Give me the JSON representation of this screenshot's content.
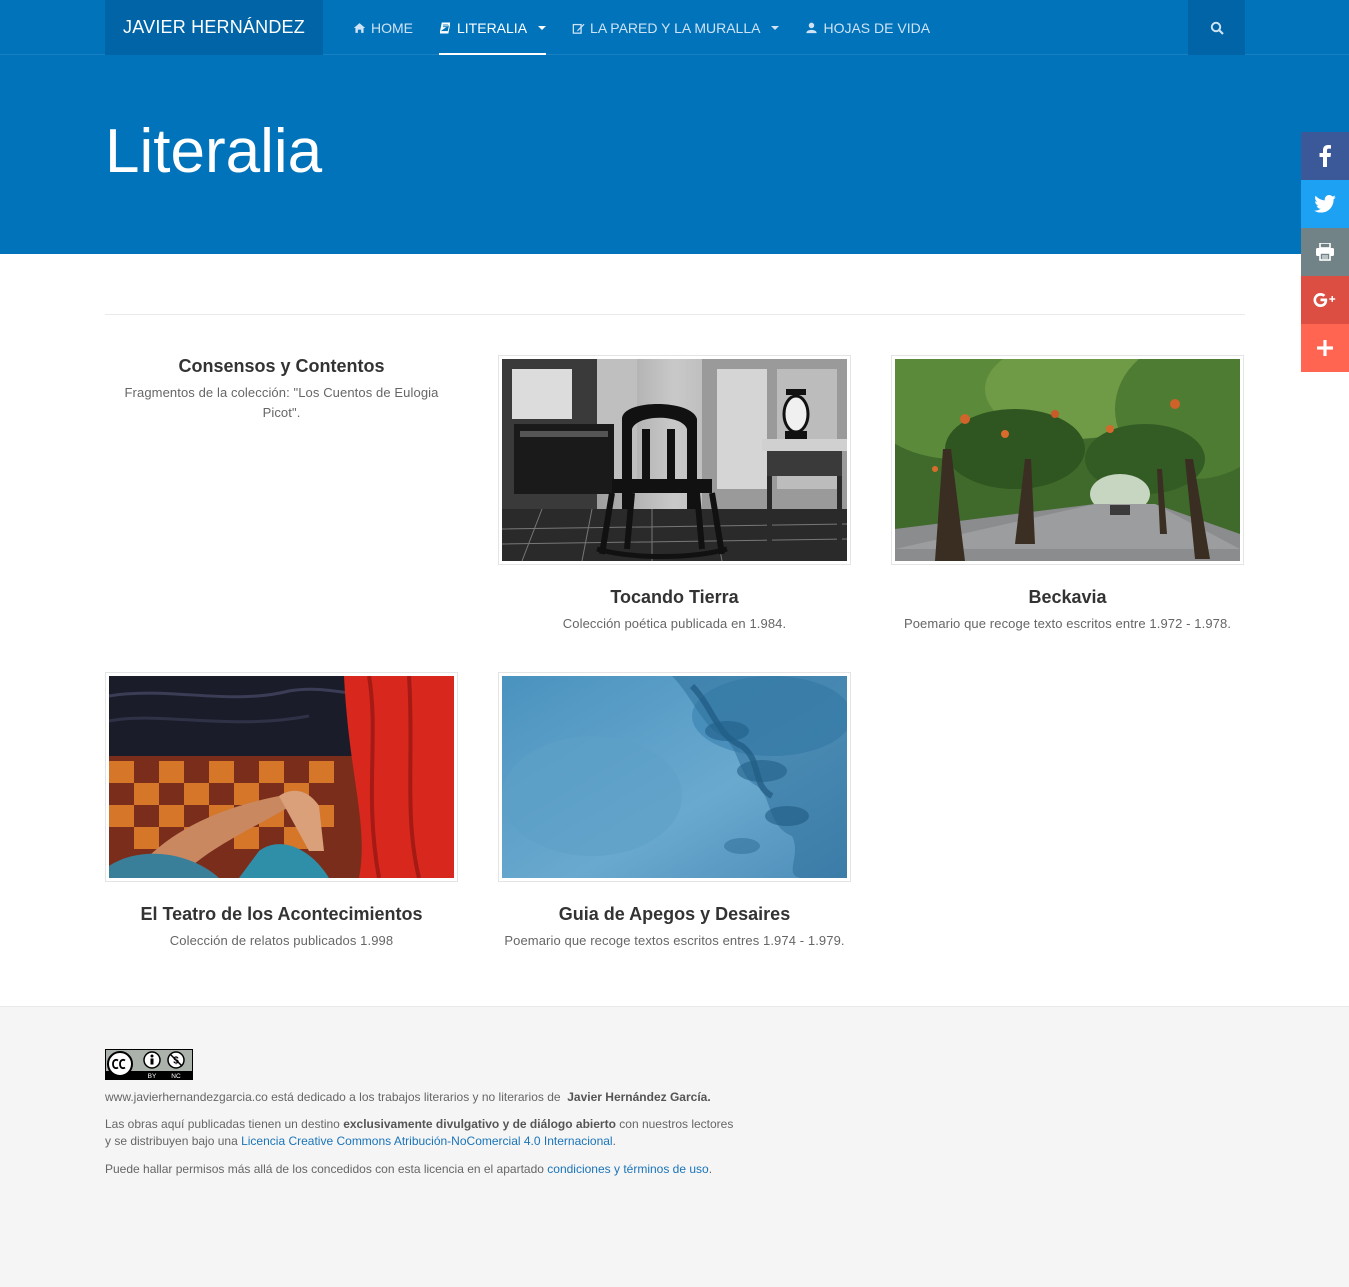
{
  "navbar": {
    "brand": "JAVIER HERNÁNDEZ",
    "items": [
      {
        "label": "HOME",
        "icon": "home-icon",
        "caret": false,
        "active": false
      },
      {
        "label": "LITERALIA",
        "icon": "book-icon",
        "caret": true,
        "active": true
      },
      {
        "label": "LA PARED Y LA MURALLA",
        "icon": "edit-icon",
        "caret": true,
        "active": false
      },
      {
        "label": "HOJAS DE VIDA",
        "icon": "user-icon",
        "caret": false,
        "active": false
      }
    ],
    "search_icon": "search-icon"
  },
  "hero": {
    "title": "Literalia"
  },
  "social": [
    {
      "name": "facebook-icon",
      "color": "#3b5998"
    },
    {
      "name": "twitter-icon",
      "color": "#1da1f2"
    },
    {
      "name": "print-icon",
      "color": "#728387"
    },
    {
      "name": "google-plus-icon",
      "color": "#dc4e41"
    },
    {
      "name": "more-icon",
      "color": "#ff6550"
    }
  ],
  "works": [
    {
      "title": "Consensos y Contentos",
      "description": "Fragmentos de la colección: \"Los Cuentos de Eulogia Picot\"."
    },
    {
      "title": "Tocando Tierra",
      "description": "Colección poética publicada en 1.984."
    },
    {
      "title": "Beckavia",
      "description": "Poemario que recoge texto escritos entre 1.972 - 1.978."
    },
    {
      "title": "El Teatro de los Acontecimientos",
      "description": "Colección de relatos publicados 1.998"
    },
    {
      "title": "Guia de Apegos y Desaires",
      "description": "Poemario que recoge textos escritos entres 1.974 - 1.979."
    }
  ],
  "footer": {
    "badge": {
      "by": "BY",
      "nc": "NC"
    },
    "line1_prefix": "www.javierhernandezgarcia.co está dedicado a los trabajos literarios y no literarios de",
    "line1_name": "Javier Hernández García.",
    "line2_prefix": "Las obras aquí publicadas tienen un destino",
    "line2_bold": "exclusivamente divulgativo y de diálogo abierto",
    "line2_suffix": "con nuestros lectores",
    "line3_prefix": "y se distribuyen bajo una",
    "line3_link": "Licencia Creative Commons Atribución-NoComercial 4.0 Internacional",
    "line3_suffix": ".",
    "line4_prefix": "Puede hallar permisos más allá de los concedidos con esta licencia en el apartado",
    "line4_link": "condiciones y términos de uso",
    "line4_suffix": "."
  },
  "colors": {
    "primary": "#0073bb",
    "brand_bg": "#0064a6",
    "footer_bg": "#f5f5f5",
    "link": "#1a74b8"
  }
}
